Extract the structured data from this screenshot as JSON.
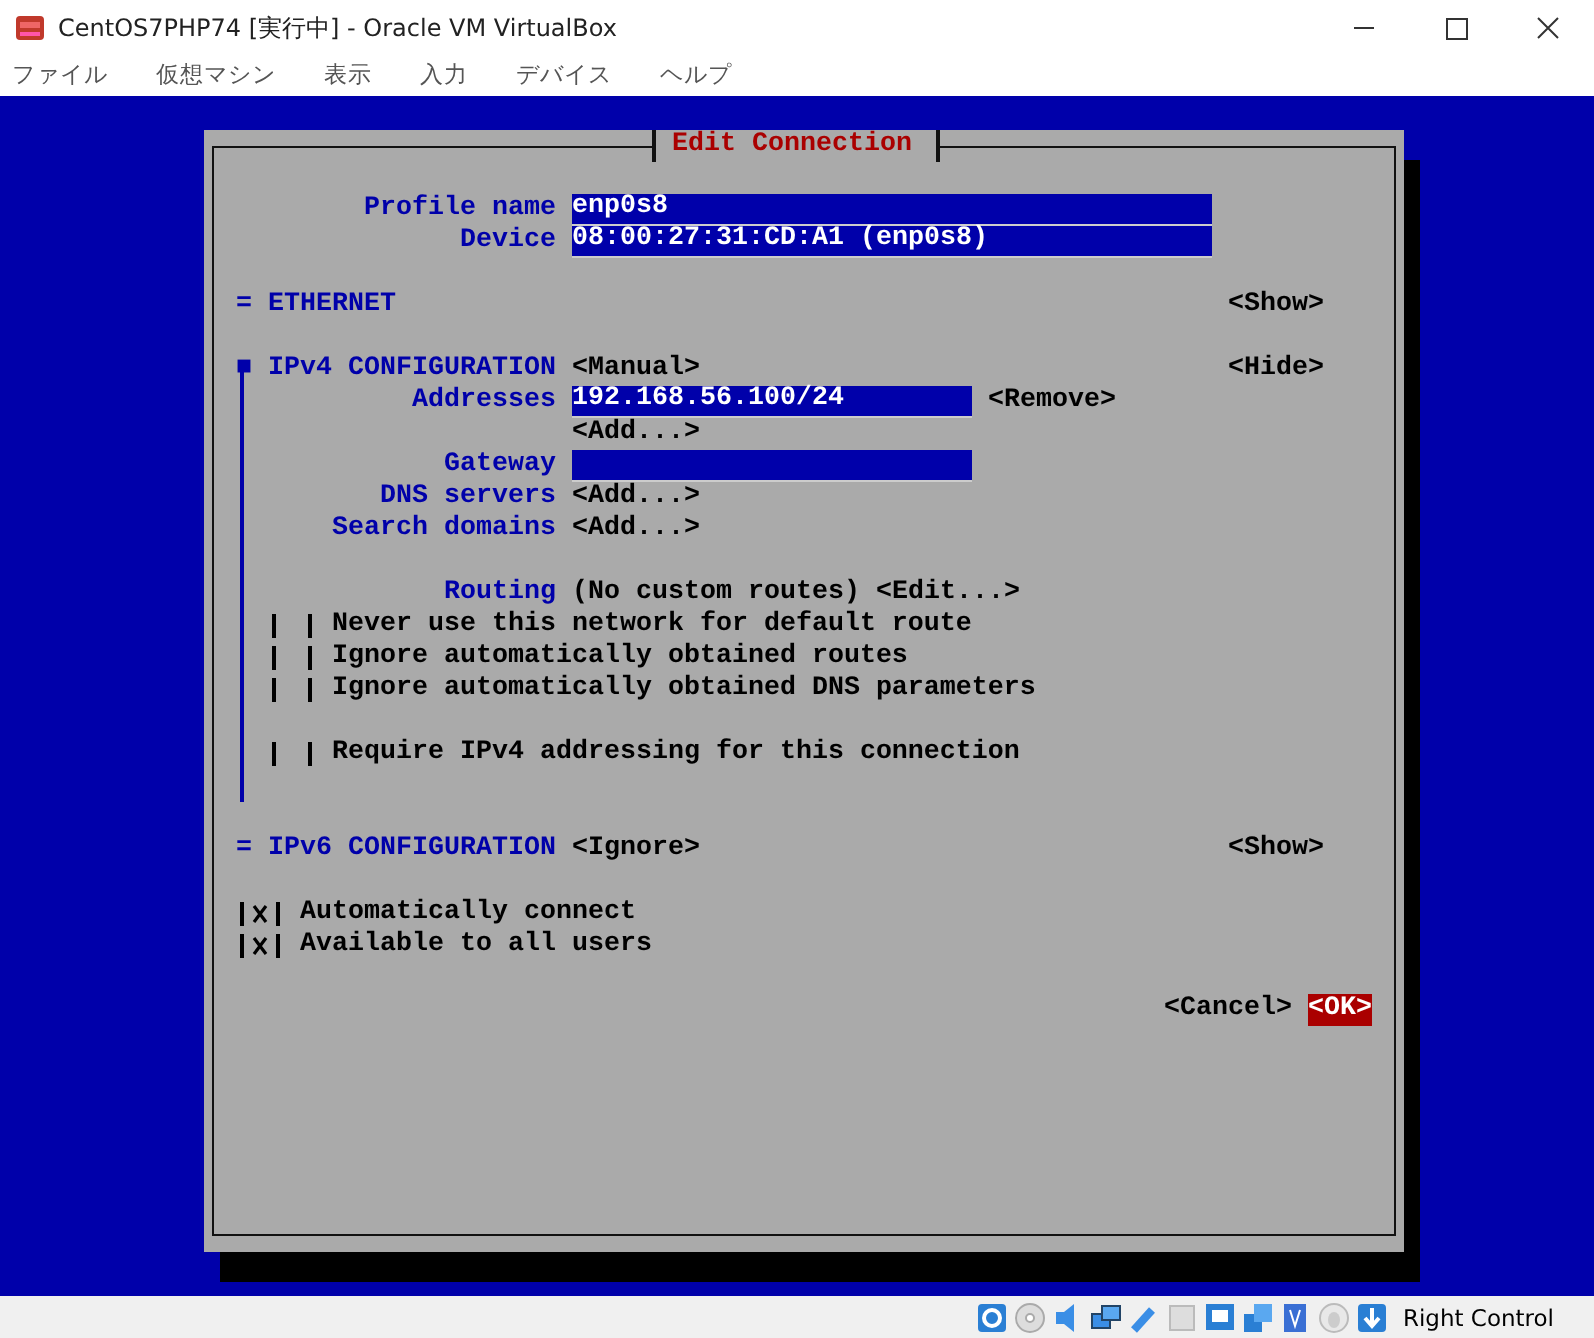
{
  "window": {
    "title": "CentOS7PHP74 [実行中] - Oracle VM VirtualBox"
  },
  "menu": [
    "ファイル",
    "仮想マシン",
    "表示",
    "入力",
    "デバイス",
    "ヘルプ"
  ],
  "dialog": {
    "title": "Edit Connection",
    "profile_name": {
      "label": "Profile name",
      "value": "enp0s8"
    },
    "device": {
      "label": "Device",
      "value": "08:00:27:31:CD:A1 (enp0s8)"
    },
    "ethernet": {
      "marker": "=",
      "label": "ETHERNET",
      "toggle": "<Show>"
    },
    "ipv4": {
      "marker": "■",
      "label": "IPv4 CONFIGURATION",
      "mode": "<Manual>",
      "toggle": "<Hide>",
      "addresses": {
        "label": "Addresses",
        "value": "192.168.56.100/24",
        "remove": "<Remove>",
        "add": "<Add...>"
      },
      "gateway": {
        "label": "Gateway"
      },
      "dns": {
        "label": "DNS servers",
        "add": "<Add...>"
      },
      "search": {
        "label": "Search domains",
        "add": "<Add...>"
      },
      "routing": {
        "label": "Routing",
        "value": "(No custom routes)",
        "edit": "<Edit...>"
      },
      "options": [
        {
          "label": "Never use this network for default route",
          "checked": false
        },
        {
          "label": "Ignore automatically obtained routes",
          "checked": false
        },
        {
          "label": "Ignore automatically obtained DNS parameters",
          "checked": false
        }
      ],
      "require": {
        "label": "Require IPv4 addressing for this connection",
        "checked": false
      }
    },
    "ipv6": {
      "marker": "=",
      "label": "IPv6 CONFIGURATION",
      "mode": "<Ignore>",
      "toggle": "<Show>"
    },
    "general": [
      {
        "label": "Automatically connect",
        "checked": true
      },
      {
        "label": "Available to all users",
        "checked": true
      }
    ],
    "buttons": [
      {
        "label": "<Cancel>",
        "selected": false
      },
      {
        "label": "<OK>",
        "selected": true
      }
    ]
  },
  "status_bar": {
    "host_key": "Right Control"
  }
}
